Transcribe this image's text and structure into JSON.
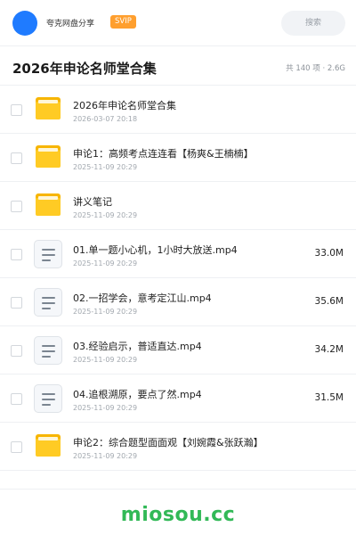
{
  "topbar": {
    "brand": "夸克网盘分享",
    "badge": "SVIP",
    "search_label": "搜索"
  },
  "header": {
    "title": "2026年申论名师堂合集",
    "summary": "共 140 项 · 2.6G"
  },
  "files": [
    {
      "type": "folder",
      "name": "2026年申论名师堂合集",
      "date": "2026-03-07 20:18",
      "size": ""
    },
    {
      "type": "folder",
      "name": "申论1：高频考点连连看【杨爽&王楠楠】",
      "date": "2025-11-09 20:29",
      "size": ""
    },
    {
      "type": "folder",
      "name": "讲义笔记",
      "date": "2025-11-09 20:29",
      "size": ""
    },
    {
      "type": "video",
      "name": "01.单一题小心机，1小时大放送.mp4",
      "date": "2025-11-09 20:29",
      "size": "33.0M"
    },
    {
      "type": "video",
      "name": "02.一招学会，意考定江山.mp4",
      "date": "2025-11-09 20:29",
      "size": "35.6M"
    },
    {
      "type": "video",
      "name": "03.经验启示，普适直达.mp4",
      "date": "2025-11-09 20:29",
      "size": "34.2M"
    },
    {
      "type": "video",
      "name": "04.追根溯原，要点了然.mp4",
      "date": "2025-11-09 20:29",
      "size": "31.5M"
    },
    {
      "type": "folder",
      "name": "申论2：综合题型面面观【刘婉霞&张跃瀚】",
      "date": "2025-11-09 20:29",
      "size": ""
    }
  ],
  "watermark": "miosou.cc",
  "colors": {
    "accent": "#1f7bff",
    "svip": "#ff9f2e",
    "folder": "#ffcb24",
    "watermark": "#32b957"
  }
}
